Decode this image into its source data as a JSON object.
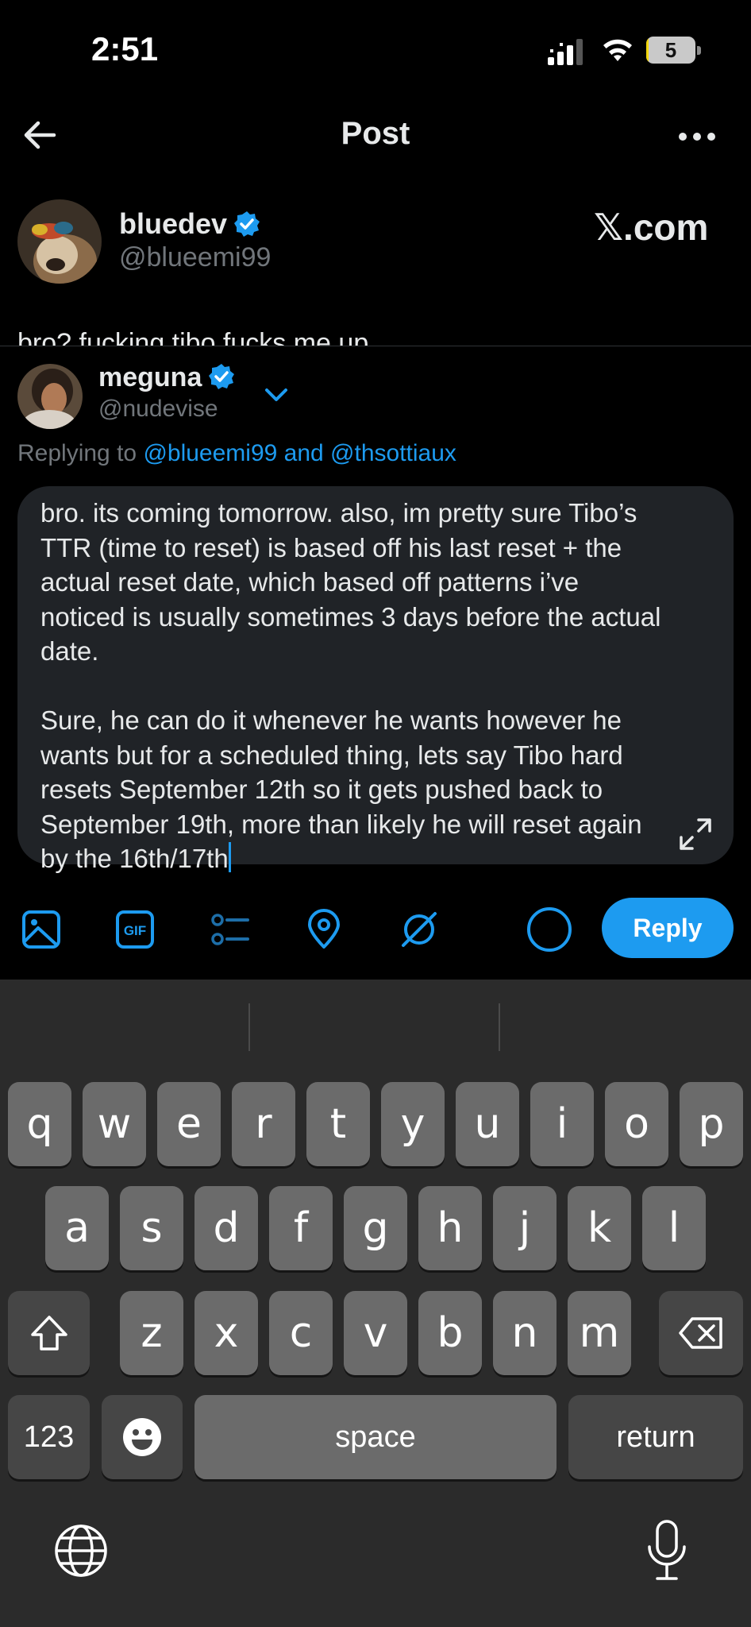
{
  "status_bar": {
    "time": "2:51",
    "battery": "5",
    "battery_level_percent": 5
  },
  "header": {
    "title": "Post"
  },
  "original_post": {
    "name": "bluedev",
    "handle": "@blueemi99",
    "source_label": "𝕏.com",
    "text_peek": "bro? fucking tibo fucks me up"
  },
  "compose": {
    "name": "meguna",
    "handle": "@nudevise",
    "replying_prefix": "Replying to",
    "replying_targets": "@blueemi99 and @thsottiaux",
    "text": "bro. its coming tomorrow. also, im pretty sure Tibo’s TTR (time to reset) is based off his last reset + the actual reset date, which based off patterns i’ve noticed is usually sometimes 3 days before the actual date.\n\nSure, he can do it whenever he wants however he wants but for a scheduled thing, lets say Tibo hard resets September 12th so it gets pushed back to September 19th, more than likely he will reset again by the 16th/17th",
    "reply_label": "Reply",
    "icons": [
      "image-icon",
      "gif-icon",
      "poll-icon",
      "location-icon",
      "grok-icon",
      "progress-ring"
    ],
    "gif_label": "GIF"
  },
  "keyboard": {
    "row1": [
      "q",
      "w",
      "e",
      "r",
      "t",
      "y",
      "u",
      "i",
      "o",
      "p"
    ],
    "row2": [
      "a",
      "s",
      "d",
      "f",
      "g",
      "h",
      "j",
      "k",
      "l"
    ],
    "row3": [
      "z",
      "x",
      "c",
      "v",
      "b",
      "n",
      "m"
    ],
    "numbers_label": "123",
    "space_label": "space",
    "return_label": "return"
  }
}
